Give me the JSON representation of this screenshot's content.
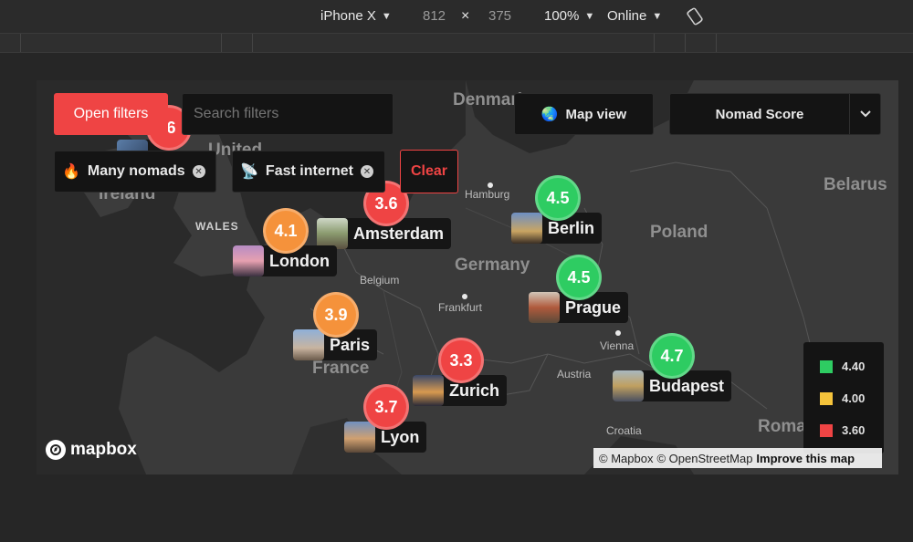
{
  "devtools": {
    "device": "iPhone X",
    "width": "812",
    "times": "×",
    "height": "375",
    "zoom": "100%",
    "network": "Online"
  },
  "filters": {
    "open_label": "Open filters",
    "search_placeholder": "Search filters",
    "chips": [
      {
        "emoji": "🔥",
        "label": "Many nomads"
      },
      {
        "emoji": "📡",
        "label": "Fast internet"
      }
    ],
    "clear_label": "Clear"
  },
  "view": {
    "emoji": "🌏",
    "label": "Map view"
  },
  "sort": {
    "label": "Nomad Score"
  },
  "map_labels": {
    "denmark": "Denmark",
    "united_kingdom": "United",
    "ireland": "Ireland",
    "wales": "WALES",
    "belarus": "Belarus",
    "poland": "Poland",
    "germany": "Germany",
    "belgium": "Belgium",
    "france": "France",
    "austria": "Austria",
    "croatia": "Croatia",
    "romania": "Roma",
    "hamburg": "Hamburg",
    "frankfurt": "Frankfurt",
    "vienna": "Vienna"
  },
  "cities": [
    {
      "name": "Berlin",
      "score": "4.5",
      "color": "#2ecc62"
    },
    {
      "name": "Amsterdam",
      "score": "3.6",
      "color": "#ef4444"
    },
    {
      "name": "London",
      "score": "4.1",
      "color": "#f5923b"
    },
    {
      "name": "Prague",
      "score": "4.5",
      "color": "#2ecc62"
    },
    {
      "name": "Paris",
      "score": "3.9",
      "color": "#f5923b"
    },
    {
      "name": "Zurich",
      "score": "3.3",
      "color": "#ef4444"
    },
    {
      "name": "Budapest",
      "score": "4.7",
      "color": "#2ecc62"
    },
    {
      "name": "Lyon",
      "score": "3.7",
      "color": "#ef4444"
    }
  ],
  "partial_marker_score": ".6",
  "legend": [
    {
      "color": "#2ecc62",
      "value": "4.40"
    },
    {
      "color": "#f5c33b",
      "value": "4.00"
    },
    {
      "color": "#ef4444",
      "value": "3.60"
    }
  ],
  "mapbox": {
    "logo_text": "mapbox",
    "attribution_1": "© Mapbox",
    "attribution_2": "© OpenStreetMap",
    "improve": "Improve this map"
  }
}
